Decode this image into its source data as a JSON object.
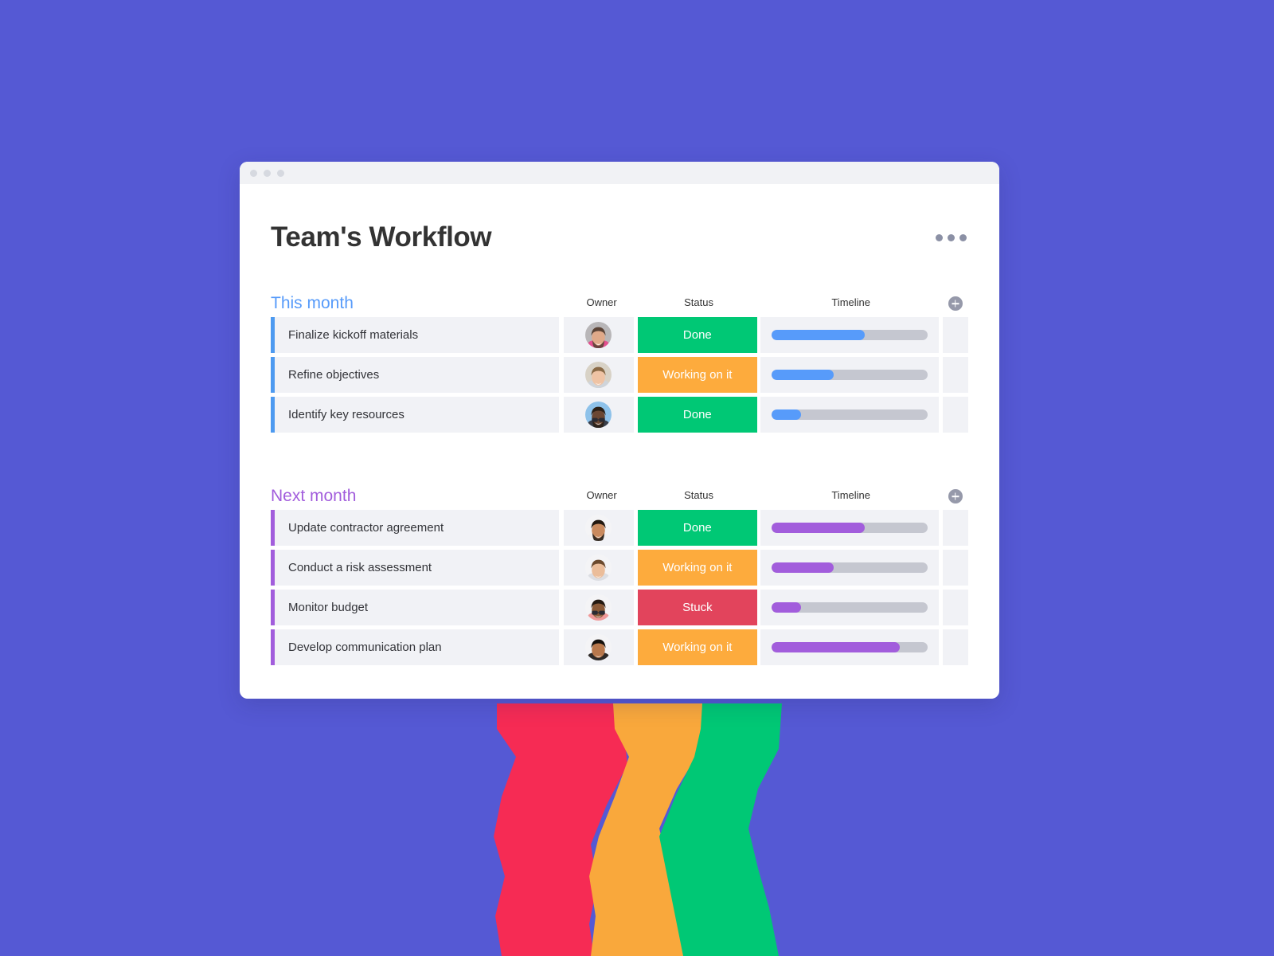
{
  "window": {
    "traffic_lights": [
      "close-dot",
      "minimize-dot",
      "maximize-dot"
    ],
    "title": "Team's Workflow",
    "overflow_menu_label": "•••"
  },
  "colors": {
    "background_purple": "#5559D4",
    "accent_blue": "#579BFA",
    "accent_purple": "#A25DDC",
    "status_done": "#00C875",
    "status_working": "#FDAB3D",
    "status_stuck": "#E2445C",
    "row_background": "#F1F2F6",
    "track_empty": "#C5C7D0",
    "timeline_blue": "#579BFA",
    "timeline_purple": "#A25DDC"
  },
  "columns": {
    "task": "",
    "owner": "Owner",
    "status": "Status",
    "timeline": "Timeline",
    "add": "add-column-button"
  },
  "groups": [
    {
      "title": "This month",
      "accent": "blue",
      "rows": [
        {
          "task": "Finalize kickoff materials",
          "owner": "avatar-bearded-man",
          "status": "Done",
          "status_color": "#00C875",
          "timeline_percent": 60,
          "timeline_color": "#579BFA"
        },
        {
          "task": "Refine objectives",
          "owner": "avatar-woman-updo",
          "status": "Working on it",
          "status_color": "#FDAB3D",
          "timeline_percent": 40,
          "timeline_color": "#579BFA"
        },
        {
          "task": "Identify key resources",
          "owner": "avatar-man-sunglasses",
          "status": "Done",
          "status_color": "#00C875",
          "timeline_percent": 19,
          "timeline_color": "#579BFA"
        }
      ]
    },
    {
      "title": "Next month",
      "accent": "purple",
      "rows": [
        {
          "task": "Update contractor agreement",
          "owner": "avatar-smiling-man",
          "status": "Done",
          "status_color": "#00C875",
          "timeline_percent": 60,
          "timeline_color": "#A25DDC"
        },
        {
          "task": "Conduct a risk assessment",
          "owner": "avatar-long-hair-woman",
          "status": "Working on it",
          "status_color": "#FDAB3D",
          "timeline_percent": 40,
          "timeline_color": "#A25DDC"
        },
        {
          "task": "Monitor budget",
          "owner": "avatar-glasses-person",
          "status": "Stuck",
          "status_color": "#E2445C",
          "timeline_percent": 19,
          "timeline_color": "#A25DDC"
        },
        {
          "task": "Develop communication plan",
          "owner": "avatar-dark-hair-woman",
          "status": "Working on it",
          "status_color": "#FDAB3D",
          "timeline_percent": 82,
          "timeline_color": "#A25DDC"
        }
      ]
    }
  ],
  "decoration": {
    "ribbon_bands": [
      {
        "name": "ribbon-band-red",
        "color": "#F62B54"
      },
      {
        "name": "ribbon-band-orange",
        "color": "#F9A83C"
      },
      {
        "name": "ribbon-band-green",
        "color": "#00C875"
      }
    ]
  }
}
